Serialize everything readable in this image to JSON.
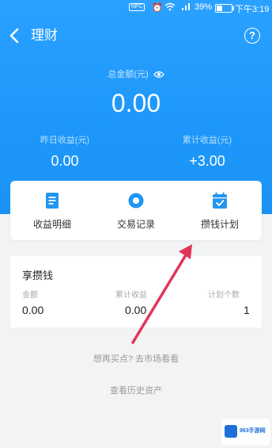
{
  "status_bar": {
    "nfc": "NFC",
    "battery_percent": "39%",
    "battery_level": 0.39,
    "time": "下午3:19"
  },
  "nav": {
    "back_icon": "chevron-left-icon",
    "title": "理财",
    "help_icon": "question-circle-icon",
    "help_glyph": "?"
  },
  "summary": {
    "total_label": "总金额(元)",
    "eye_icon": "eye-icon",
    "total_value": "0.00",
    "yesterday_label": "昨日收益(元)",
    "yesterday_value": "0.00",
    "cumulative_label": "累计收益(元)",
    "cumulative_value": "+3.00"
  },
  "shortcuts": [
    {
      "label": "收益明细",
      "icon": "document-icon"
    },
    {
      "label": "交易记录",
      "icon": "record-circle-icon"
    },
    {
      "label": "攒钱计划",
      "icon": "calendar-check-icon"
    }
  ],
  "product": {
    "title": "享攒钱",
    "columns": [
      {
        "label": "金额",
        "value": "0.00"
      },
      {
        "label": "累计收益",
        "value": "0.00"
      },
      {
        "label": "计划个数",
        "value": "1"
      }
    ]
  },
  "links": {
    "market": "想再买点? 去市场看看",
    "history": "查看历史资产"
  },
  "colors": {
    "hero_blue": "#1d97fb",
    "icon_blue": "#2196f3",
    "arrow_red": "#e2345a"
  },
  "watermark": {
    "text": "963手游网"
  }
}
